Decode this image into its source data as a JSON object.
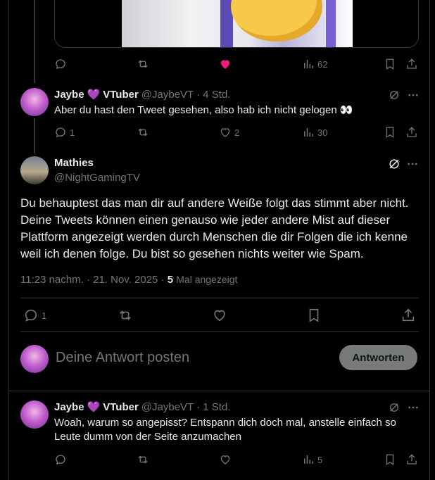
{
  "prev_tweet": {
    "stats": {
      "views": "62"
    }
  },
  "reply1": {
    "author_name": "Jaybe",
    "heart_emoji": "💜",
    "author_suffix": "VTuber",
    "handle_time": "@JaybeVT · 4 Std.",
    "text": "Aber du hast den Tweet gesehen, also hab ich nicht gelogen 👀",
    "stats": {
      "replies": "1",
      "likes": "2",
      "views": "30"
    }
  },
  "main_tweet": {
    "author_name": "Mathies",
    "handle": "@NightGamingTV",
    "text": "Du behauptest das man dir auf andere Weiße folgt das stimmt aber nicht. Deine Tweets können einen genauso wie jeder andere Mist auf dieser Plattform angezeigt werden durch Menschen die dir Folgen die ich kenne weil ich denen folge. Du bist so gesehen nichts weiter wie Spam.",
    "timestamp": "11:23 nachm. · 21. Nov. 2025 · ",
    "view_count": "5",
    "view_label": "Mal angezeigt",
    "stats": {
      "replies": "1"
    }
  },
  "composer": {
    "placeholder": "Deine Antwort posten",
    "button_label": "Antworten"
  },
  "reply2": {
    "author_name": "Jaybe",
    "heart_emoji": "💜",
    "author_suffix": "VTuber",
    "handle_time": "@JaybeVT · 1 Std.",
    "text": "Woah, warum so angepisst? Entspann dich doch mal, anstelle einfach so Leute dumm von der Seite anzumachen",
    "stats": {
      "views": "5"
    }
  },
  "colors": {
    "accent_like": "#f91880",
    "muted": "#71767b",
    "text": "#e7e9ea",
    "border": "#2f3336"
  }
}
